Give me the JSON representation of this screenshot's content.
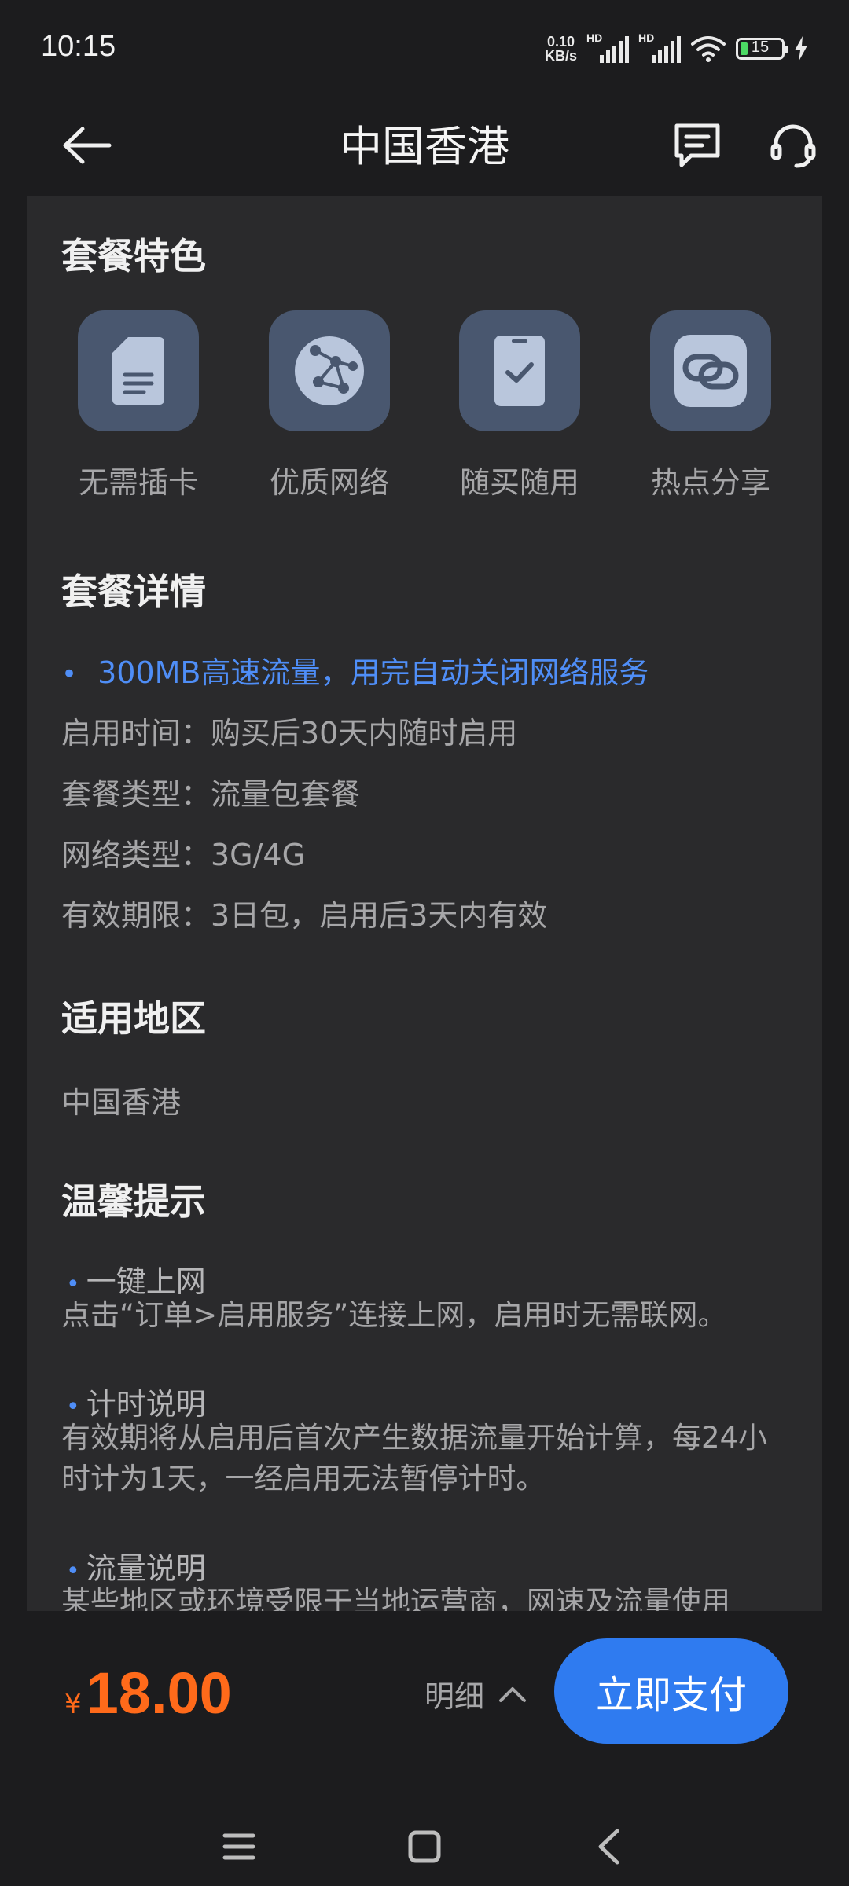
{
  "status_bar": {
    "time": "10:15",
    "net_speed_value": "0.10",
    "net_speed_unit": "KB/s",
    "sim1_label": "HD",
    "sim2_label": "HD",
    "battery_level": "15"
  },
  "header": {
    "title": "中国香港",
    "icons": [
      "back-arrow-icon",
      "message-icon",
      "customer-service-icon"
    ]
  },
  "features": {
    "title": "套餐特色",
    "items": [
      {
        "label": "无需插卡",
        "icon": "sim-card-icon"
      },
      {
        "label": "优质网络",
        "icon": "network-globe-icon"
      },
      {
        "label": "随买随用",
        "icon": "phone-check-icon"
      },
      {
        "label": "热点分享",
        "icon": "hotspot-link-icon"
      }
    ]
  },
  "details": {
    "title": "套餐详情",
    "highlight": "300MB高速流量，用完自动关闭网络服务",
    "lines": [
      "启用时间：购买后30天内随时启用",
      "套餐类型：流量包套餐",
      "网络类型：3G/4G",
      "有效期限：3日包，启用后3天内有效"
    ]
  },
  "region": {
    "title": "适用地区",
    "value": "中国香港"
  },
  "tips": {
    "title": "温馨提示",
    "items": [
      {
        "heading": "一键上网",
        "text": "点击“订单>启用服务”连接上网，启用时无需联网。"
      },
      {
        "heading": "计时说明",
        "text": "有效期将从启用后首次产生数据流量开始计算，每24小时计为1天，一经启用无法暂停计时。"
      },
      {
        "heading": "流量说明",
        "text": "某些地区或环境受限于当地运营商，网速及流量使用"
      }
    ]
  },
  "bottom": {
    "currency": "¥",
    "price": "18.00",
    "details_label": "明细",
    "pay_label": "立即支付"
  },
  "colors": {
    "accent_blue": "#2f7bf0",
    "link_blue": "#4f8ef7",
    "price_orange": "#ff6a1a",
    "tile_bg": "#49576f"
  }
}
